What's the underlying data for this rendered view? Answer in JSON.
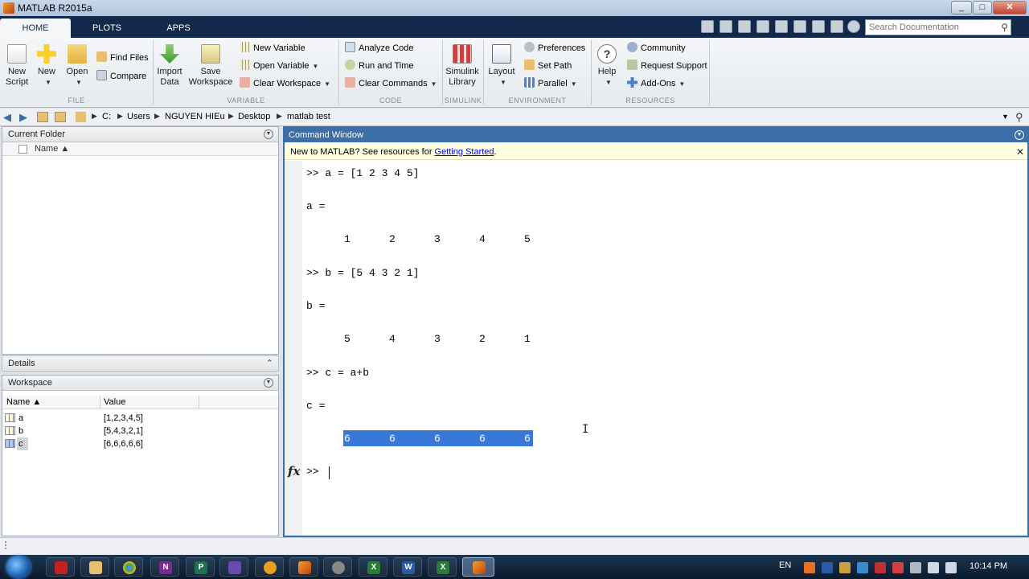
{
  "window": {
    "title": "MATLAB R2015a",
    "buttons": [
      "_",
      "□",
      "✕"
    ]
  },
  "tabs": [
    {
      "label": "HOME",
      "active": true
    },
    {
      "label": "PLOTS",
      "active": false
    },
    {
      "label": "APPS",
      "active": false
    }
  ],
  "search": {
    "placeholder": "Search Documentation"
  },
  "ribbon": {
    "file": {
      "group_label": "FILE",
      "new_script": [
        "New",
        "Script"
      ],
      "new": "New",
      "open": "Open",
      "find_files": "Find Files",
      "compare": "Compare"
    },
    "variable": {
      "group_label": "VARIABLE",
      "import_data": [
        "Import",
        "Data"
      ],
      "save_workspace": [
        "Save",
        "Workspace"
      ],
      "new_variable": "New Variable",
      "open_variable": "Open Variable",
      "clear_workspace": "Clear Workspace"
    },
    "code": {
      "group_label": "CODE",
      "analyze_code": "Analyze Code",
      "run_and_time": "Run and Time",
      "clear_commands": "Clear Commands"
    },
    "simulink": {
      "group_label": "SIMULINK",
      "simulink_library": [
        "Simulink",
        "Library"
      ]
    },
    "environment": {
      "group_label": "ENVIRONMENT",
      "layout": "Layout",
      "preferences": "Preferences",
      "set_path": "Set Path",
      "parallel": "Parallel"
    },
    "resources": {
      "group_label": "RESOURCES",
      "help": "Help",
      "community": "Community",
      "request_support": "Request Support",
      "add_ons": "Add-Ons"
    }
  },
  "address": {
    "path": [
      "C:",
      "Users",
      "NGUYEN HIEu",
      "Desktop",
      "matlab test"
    ]
  },
  "current_folder": {
    "title": "Current Folder",
    "column_name": "Name ▲"
  },
  "details": {
    "title": "Details"
  },
  "workspace": {
    "title": "Workspace",
    "columns": [
      "Name ▲",
      "Value"
    ],
    "rows": [
      {
        "name": "a",
        "value": "[1,2,3,4,5]"
      },
      {
        "name": "b",
        "value": "[5,4,3,2,1]"
      },
      {
        "name": "c",
        "value": "[6,6,6,6,6]"
      }
    ]
  },
  "command_window": {
    "title": "Command Window",
    "info_text": "New to MATLAB? See resources for ",
    "info_link": "Getting Started",
    "info_suffix": ".",
    "lines": [
      ">> a = [1 2 3 4 5]",
      "a =",
      ">> b = [5 4 3 2 1]",
      "b =",
      ">> c = a+b",
      "c ="
    ],
    "a_values": [
      "1",
      "2",
      "3",
      "4",
      "5"
    ],
    "b_values": [
      "5",
      "4",
      "3",
      "2",
      "1"
    ],
    "c_values": [
      "6",
      "6",
      "6",
      "6",
      "6"
    ],
    "prompt": ">>",
    "fx": "fx"
  },
  "taskbar": {
    "language": "EN",
    "clock": "10:14 PM"
  }
}
